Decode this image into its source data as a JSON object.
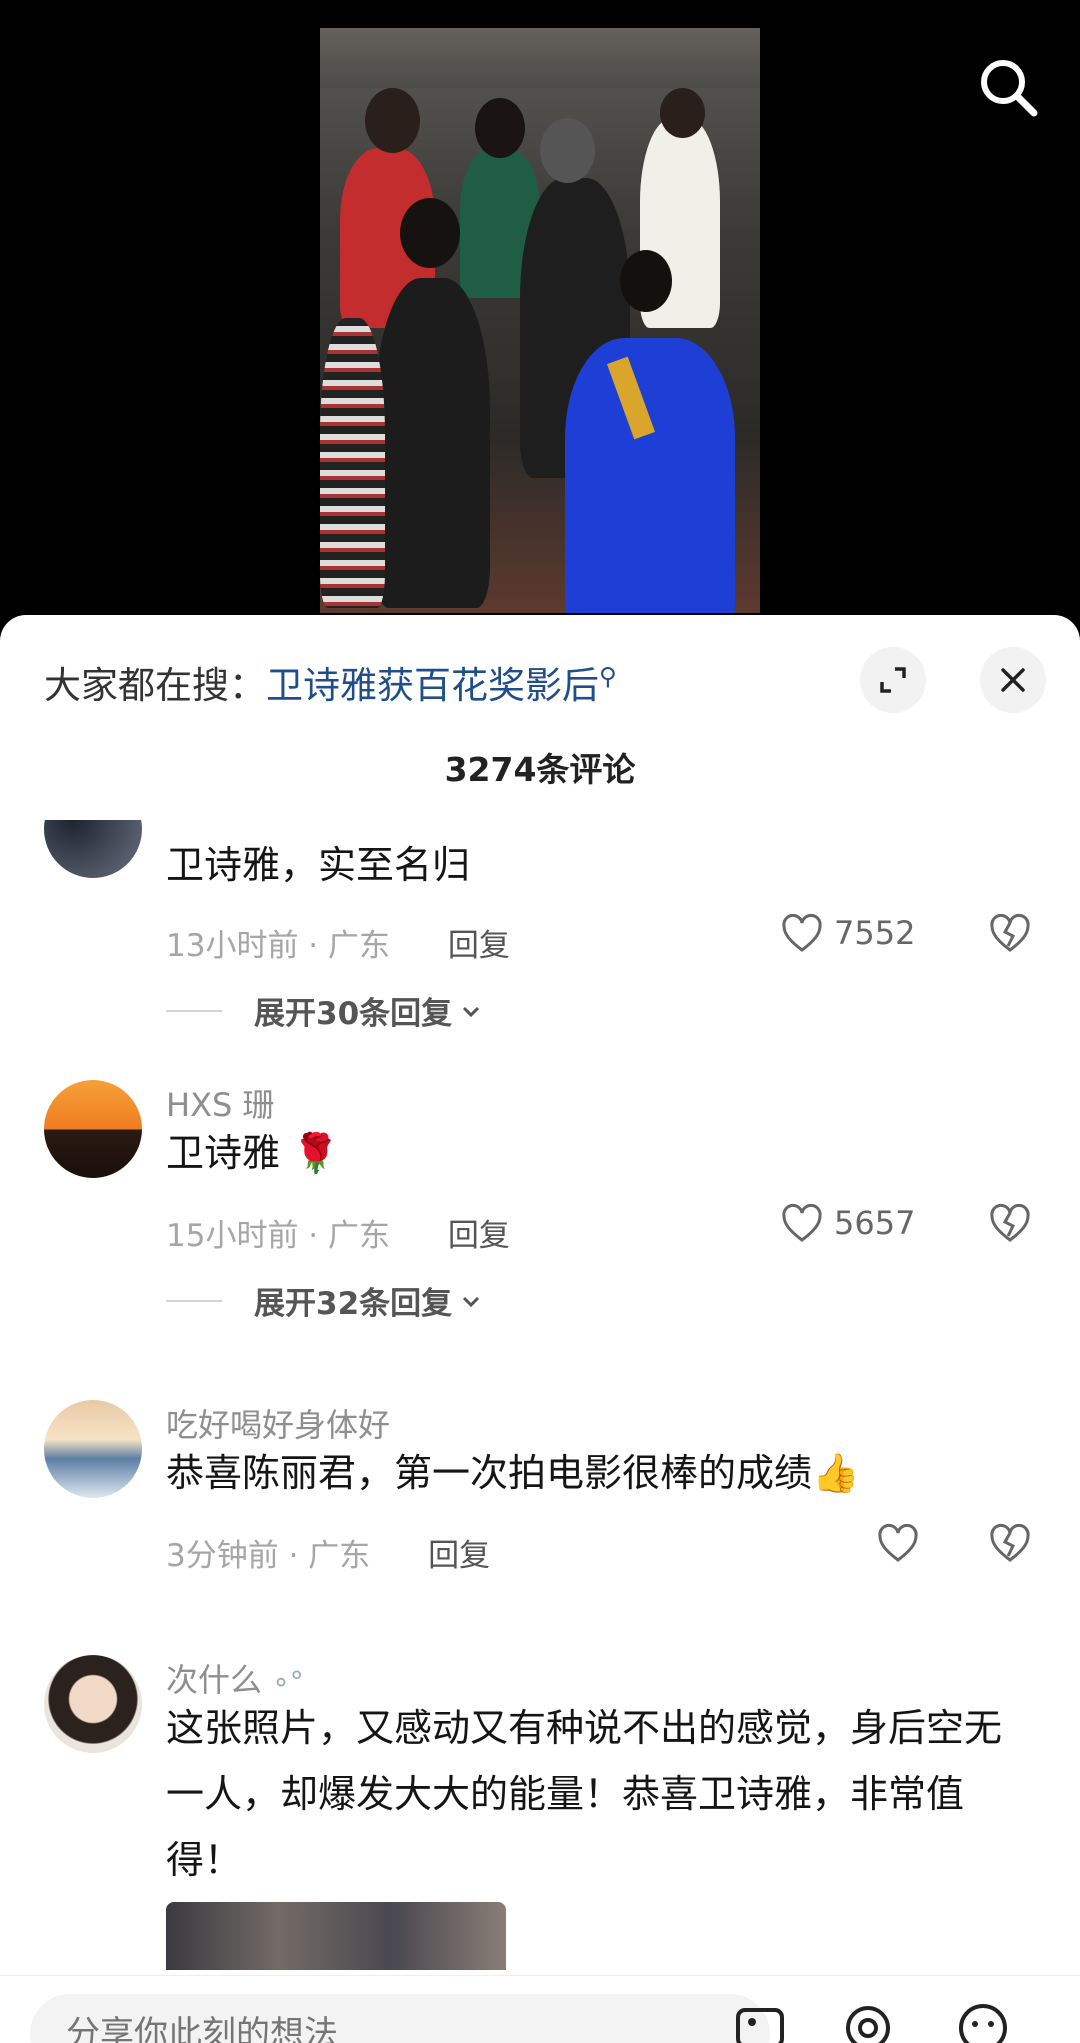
{
  "trending": {
    "prefix": "大家都在搜：",
    "query": "卫诗雅获百花奖影后"
  },
  "comment_count": "3274条评论",
  "comments": [
    {
      "user": "",
      "text": "卫诗雅，实至名归",
      "time": "13小时前 · 广东",
      "reply": "回复",
      "likes": "7552",
      "expand": "展开30条回复"
    },
    {
      "user": "HXS 珊",
      "text": "卫诗雅 🌹",
      "time": "15小时前 · 广东",
      "reply": "回复",
      "likes": "5657",
      "expand": "展开32条回复"
    },
    {
      "user": "吃好喝好身体好",
      "text": "恭喜陈丽君，第一次拍电影很棒的成绩👍",
      "time": "3分钟前 · 广东",
      "reply": "回复",
      "likes": ""
    },
    {
      "user": "次什么",
      "text": "这张照片，又感动又有种说不出的感觉，身后空无一人，却爆发大大的能量！恭喜卫诗雅，非常值得！",
      "time": "",
      "reply": ""
    }
  ],
  "input_placeholder": "分享你此刻的想法",
  "icons": [
    "search-icon",
    "expand-icon",
    "close-icon",
    "heart-icon",
    "broken-heart-icon",
    "chevron-down-icon",
    "image-icon",
    "at-icon",
    "emoji-icon"
  ]
}
